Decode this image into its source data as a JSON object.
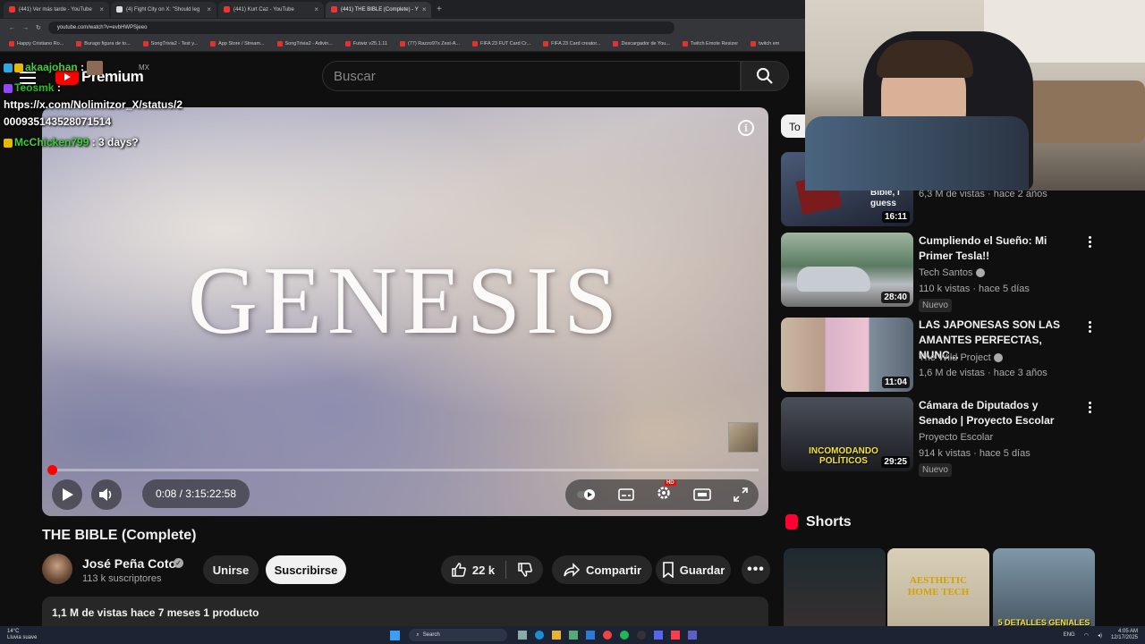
{
  "browser": {
    "tabs": [
      {
        "label": "(441) Ver más tarde - YouTube",
        "active": false
      },
      {
        "label": "(4) Fight City on X: \"Should leg",
        "active": false
      },
      {
        "label": "(441) Kurt Caz - YouTube",
        "active": false
      },
      {
        "label": "(441) THE BIBLE (Complete) - Y",
        "active": true
      }
    ],
    "url": "youtube.com/watch?v=evbHWPSjeeo",
    "bookmarks": [
      "Happy Cristiano Ro...",
      "Burago figura de to...",
      "SongTrivia2 - Test y...",
      "App Store / Stream...",
      "SongTrivia2 - Adivin...",
      "Futwiz v25.1.11",
      "(77) Razzo97s Zest-A...",
      "FIFA 23 FUT Card Cr...",
      "FIFA 23 Card creator...",
      "Descargador de You...",
      "Twitch Emote Resizer",
      "twitch em"
    ]
  },
  "header": {
    "logo_text": "Premium",
    "country": "MX",
    "search_placeholder": "Buscar"
  },
  "chat": [
    {
      "user": "akaajohan",
      "text": ":"
    },
    {
      "user": "Teosmk",
      "text": ":"
    },
    {
      "user": "",
      "text": "https://x.com/Nolimitzor_X/status/2"
    },
    {
      "user": "",
      "text": "000935143528071514"
    },
    {
      "user": "McChicken799",
      "text": ": 3 days?"
    }
  ],
  "video": {
    "overlay_text": "GENESIS",
    "time_display": "0:08 / 3:15:22:58",
    "progress": 0.0007,
    "hd_badge": "HD"
  },
  "meta": {
    "title": "THE BIBLE (Complete)",
    "channel": "José Peña Coto",
    "subscribers": "113 k suscriptores",
    "join_label": "Unirse",
    "subscribe_label": "Suscribirse",
    "likes": "22 k",
    "share_label": "Compartir",
    "save_label": "Guardar",
    "description_line": "1,1 M de vistas  hace 7 meses  1 producto"
  },
  "sidebar": {
    "chip_label": "To",
    "items": [
      {
        "title": "",
        "channel": "",
        "meta": "6,3 M de vistas · hace 2 años",
        "duration": "16:11",
        "thumb_caption": "Bible, i guess",
        "nuevo": ""
      },
      {
        "title": "Cumpliendo el Sueño: Mi Primer Tesla!!",
        "channel": "Tech Santos",
        "meta": "110 k vistas · hace 5 días",
        "duration": "28:40",
        "nuevo": "Nuevo"
      },
      {
        "title": "LAS JAPONESAS SON LAS AMANTES PERFECTAS, NUNC...",
        "channel": "The Wild Project",
        "meta": "1,6 M de vistas · hace 3 años",
        "duration": "11:04",
        "nuevo": ""
      },
      {
        "title": "Cámara de Diputados y Senado | Proyecto Escolar",
        "channel": "Proyecto Escolar",
        "meta": "914 k vistas · hace 5 días",
        "duration": "29:25",
        "thumb_caption": "INCOMODANDO POLÍTICOS",
        "nuevo": "Nuevo"
      }
    ],
    "shorts_label": "Shorts",
    "shorts": [
      {
        "caption": ""
      },
      {
        "caption": "AESTHETIC HOME TECH"
      },
      {
        "caption": "5 DETALLES GENIALES DE INZOI:"
      }
    ]
  },
  "taskbar": {
    "weather_temp": "14°C",
    "weather_desc": "Lluvia suave",
    "search_label": "Search",
    "lang": "ENG",
    "time": "4:05 AM",
    "date": "12/17/2025"
  },
  "colors": {
    "accent": "#ff0000",
    "background": "#0f0f0f",
    "chat_user": "#3ad13a"
  }
}
